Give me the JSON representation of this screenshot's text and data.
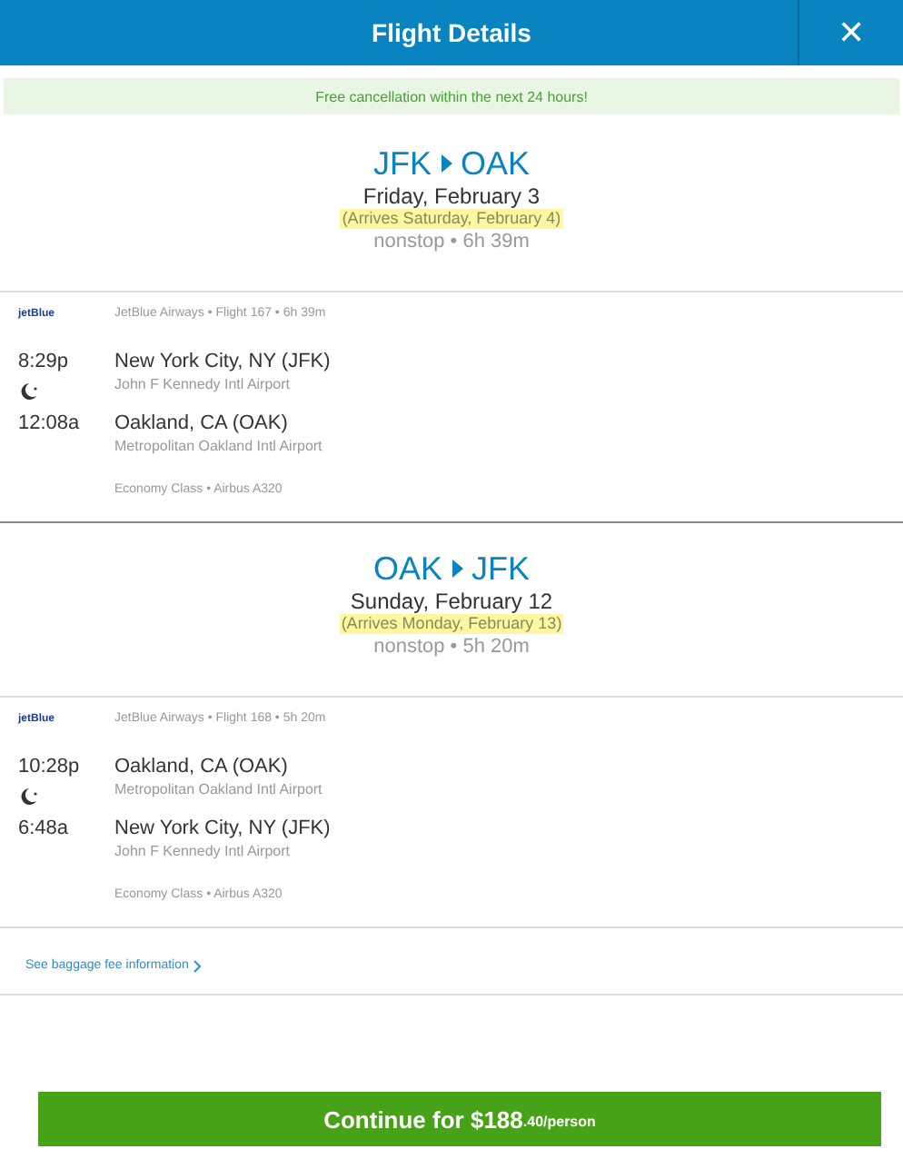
{
  "header": {
    "title": "Flight Details",
    "close": "✕"
  },
  "banner": "Free cancellation within the next 24 hours!",
  "trips": [
    {
      "origin": "JFK",
      "destination": "OAK",
      "date": "Friday, February 3",
      "arrives": "(Arrives Saturday, February 4)",
      "summary": "nonstop • 6h 39m",
      "airline_logo": "jetBlue",
      "flight_info": "JetBlue Airways • Flight 167 • 6h 39m",
      "depart_time": "8:29p",
      "depart_city": "New York City, NY (JFK)",
      "depart_airport": "John F Kennedy Intl Airport",
      "overnight": true,
      "arrive_time": "12:08a",
      "arrive_city": "Oakland, CA (OAK)",
      "arrive_airport": "Metropolitan Oakland Intl Airport",
      "cabin": "Economy Class • Airbus A320"
    },
    {
      "origin": "OAK",
      "destination": "JFK",
      "date": "Sunday, February 12",
      "arrives": "(Arrives Monday, February 13)",
      "summary": "nonstop • 5h 20m",
      "airline_logo": "jetBlue",
      "flight_info": "JetBlue Airways • Flight 168 • 5h 20m",
      "depart_time": "10:28p",
      "depart_city": "Oakland, CA (OAK)",
      "depart_airport": "Metropolitan Oakland Intl Airport",
      "overnight": true,
      "arrive_time": "6:48a",
      "arrive_city": "New York City, NY (JFK)",
      "arrive_airport": "John F Kennedy Intl Airport",
      "cabin": "Economy Class • Airbus A320"
    }
  ],
  "baggage_link": "See baggage fee information",
  "continue_button": {
    "main": "Continue for $188",
    "small": ".40/person"
  }
}
